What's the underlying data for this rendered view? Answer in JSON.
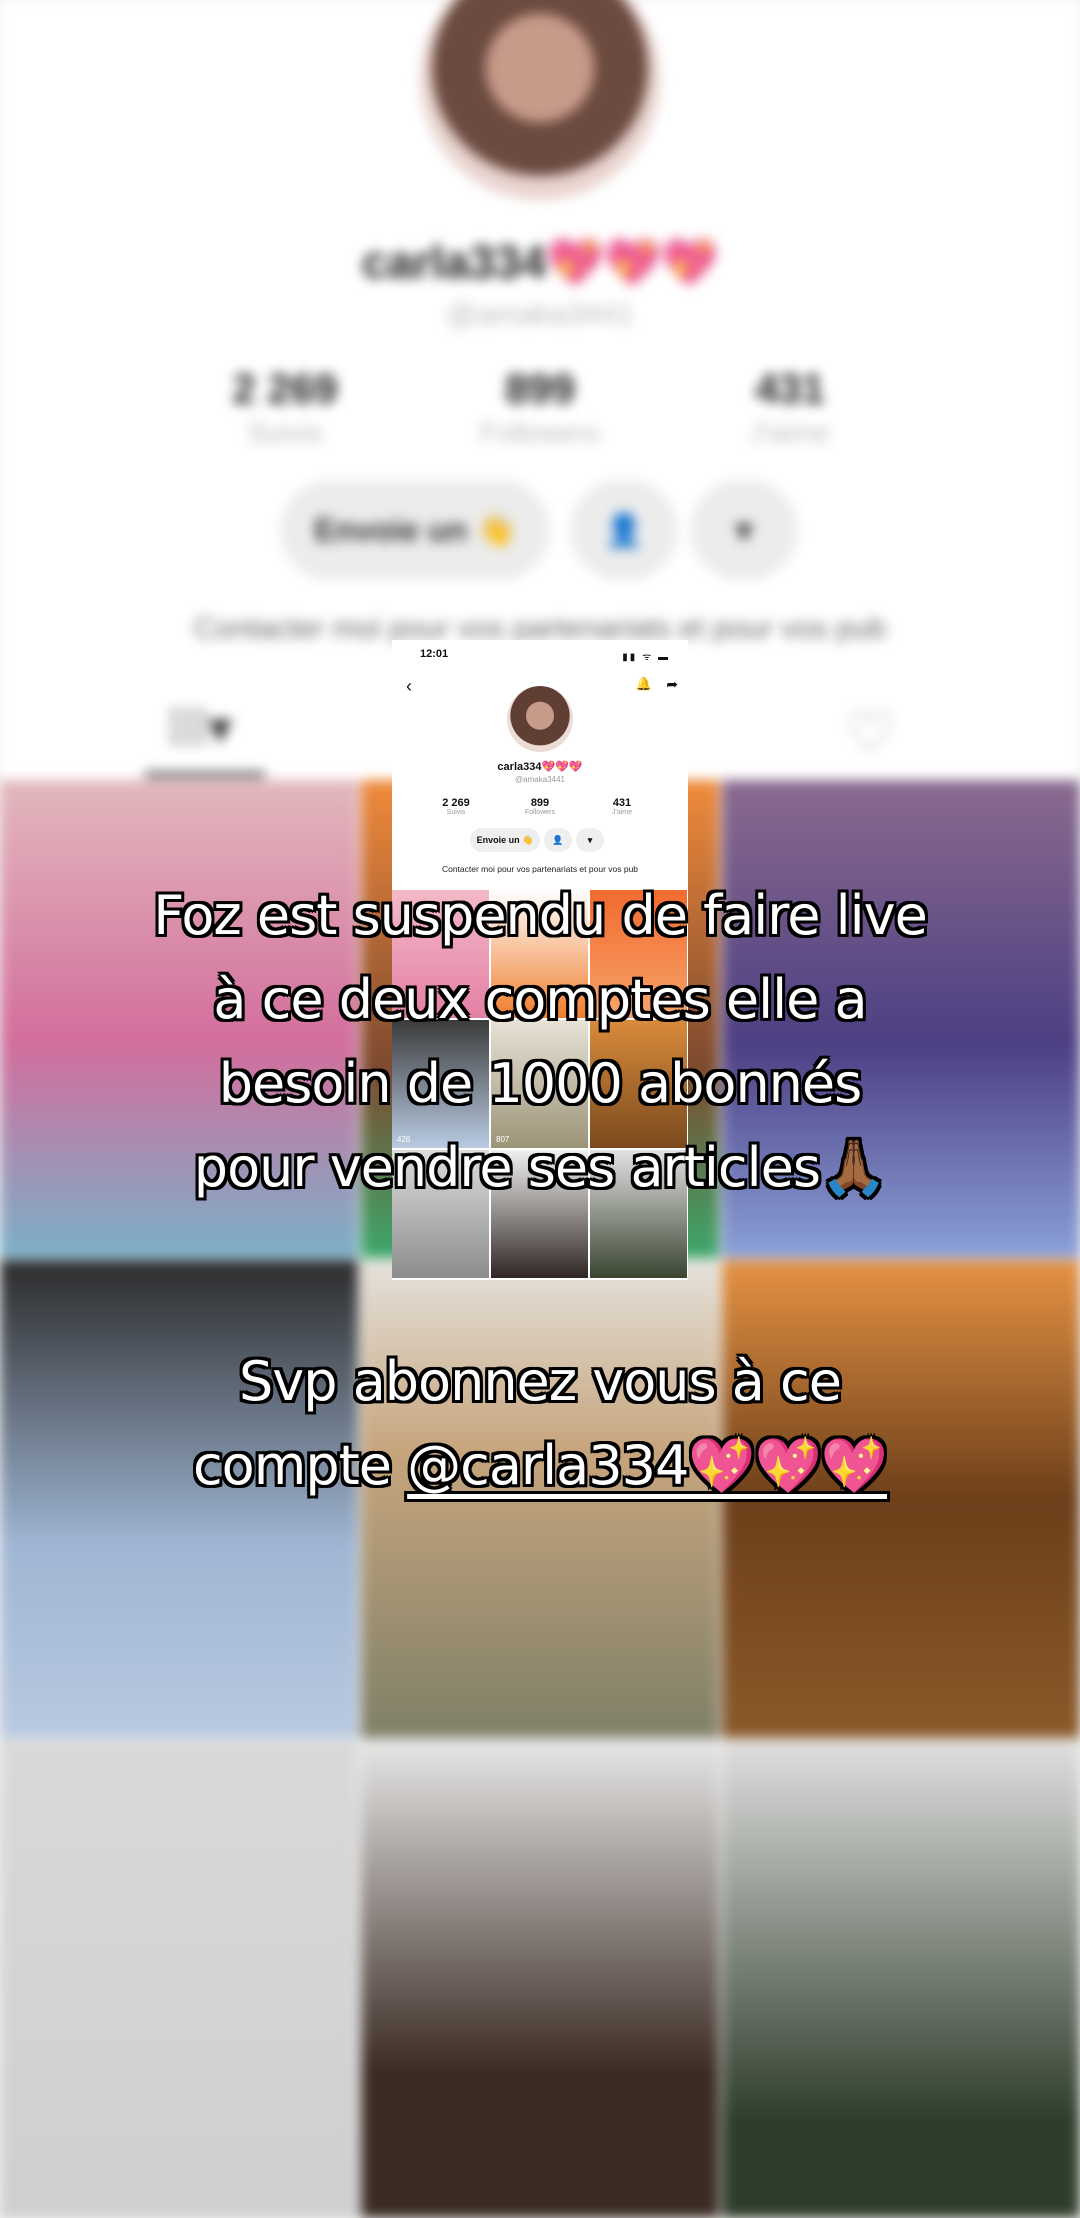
{
  "profile": {
    "name": "carla334💖💖💖",
    "handle": "@amaka3441",
    "stats": [
      {
        "value": "2 269",
        "label": "Suivis"
      },
      {
        "value": "899",
        "label": "Followers"
      },
      {
        "value": "431",
        "label": "J'aime"
      }
    ],
    "message_button": "Envoie un 👋",
    "bio": "Contacter moi pour vos partenariats et pour vos pub"
  },
  "inset": {
    "time": "12:01",
    "status_icons": "▮▮ ᯤ ▬",
    "name": "carla334💖💖💖",
    "handle": "@amaka3441",
    "stats": [
      {
        "value": "2 269",
        "label": "Suivis"
      },
      {
        "value": "899",
        "label": "Followers"
      },
      {
        "value": "431",
        "label": "J'aime"
      }
    ],
    "message_button": "Envoie un 👋",
    "bio": "Contacter moi pour vos partenariats et pour vos pub",
    "video_counts": [
      "426",
      "807"
    ]
  },
  "caption": {
    "line1": "Foz est suspendu de faire live",
    "line2": "à ce deux comptes elle a",
    "line3": "besoin de 1000 abonnés",
    "line4": "pour vendre ses articles🙏🏾",
    "line5": "Svp abonnez vous à ce",
    "line6_prefix": "compte ",
    "line6_mention": "@carla334💖💖💖"
  }
}
